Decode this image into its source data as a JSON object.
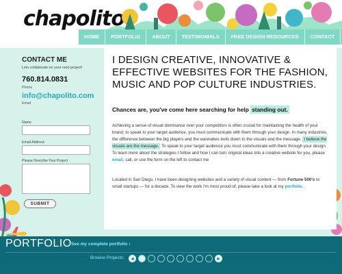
{
  "brand": {
    "logo_text": "chapolito"
  },
  "nav": {
    "items": [
      {
        "label": "HOME"
      },
      {
        "label": "PORTFOLIO"
      },
      {
        "label": "ABOUT"
      },
      {
        "label": "TESTIMONIALS"
      },
      {
        "label": "FREE DESIGN RESOURCES"
      },
      {
        "label": "CONTACT"
      }
    ]
  },
  "contact": {
    "title": "CONTACT ME",
    "intro": "Lets collaborate on your next project!",
    "phone": "760.814.0831",
    "phone_label": "Phone",
    "email": "info@chapolito.com",
    "email_label": "Email",
    "form": {
      "name_label": "Name",
      "email_label": "Email Address",
      "project_label": "Please Describe Your Project",
      "submit_label": "SUBMIT"
    }
  },
  "main": {
    "headline": "I DESIGN CREATIVE, INNOVATIVE & EFFECTIVE WEBSITES FOR THE FASHION, MUSIC AND POP CULTURE INDUSTRIES.",
    "tagline_prefix": "Chances are, you've come here searching for help",
    "tagline_highlight": "standing out.",
    "p1_a": "Achieving a sense of visual dominance over your competitors is often crucial for maintaining the health of your brand; to speak to your target audience, you must communicate with them through your design. In many industries, the difference between the big players and the wannabes boils down to the visuals and the message.",
    "p1_highlight": "I believe the visuals are the message.",
    "p1_b": "To speak to your target audience you must communicate with them through your design. To learn more about the strategies I follow and how I can turn original ideas into a creative website for you, please",
    "p1_email_link": "email",
    "p1_c": ", call, or use the form on the left to contact me",
    "p2_a": "Located in San Diego, I have been designing websites and a variety of visual content — from",
    "p2_bold": "Fortune 500's",
    "p2_b": "to small startups — for a decade. To view the work I'm most proud of, please take a look at my",
    "p2_link": "portfolio",
    "p2_c": "."
  },
  "portfolio": {
    "title": "PORTFOLIO",
    "link": "See my complete portfolio ›",
    "browse_label": "Browse Projects:",
    "pager": {
      "pages": 8,
      "active_index": 0
    }
  },
  "colors": {
    "background": "#d7f2ea",
    "nav": "#7fd8c3",
    "accent": "#2aa8b8",
    "portfolio_bar": "#0f6a78",
    "highlight": "#b9ecdf"
  }
}
